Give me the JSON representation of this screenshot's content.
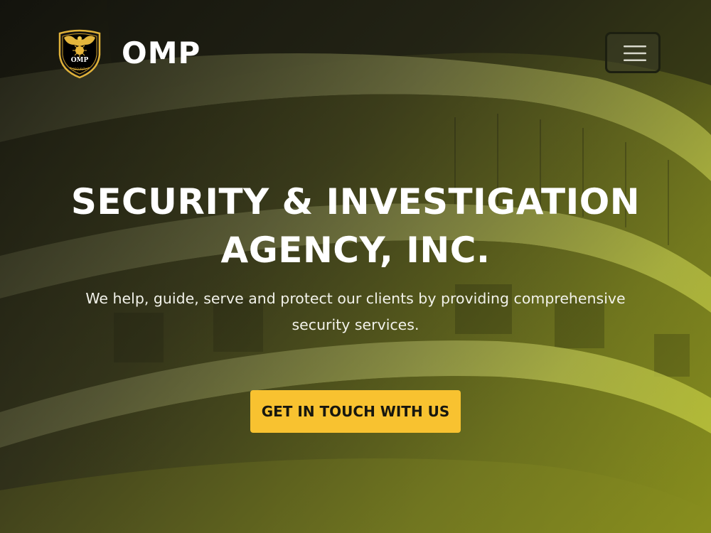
{
  "brand": {
    "name": "OMP",
    "logo_icon": "eagle-shield-logo-icon",
    "logo_text": "OMP",
    "logo_ribbon": "SECURITY"
  },
  "nav": {
    "toggle_icon": "hamburger-menu-icon"
  },
  "hero": {
    "title_line1": "SECURITY & INVESTIGATION",
    "title_line2": "AGENCY, INC.",
    "subtitle_line1": "We help, guide, serve and protect our clients by providing comprehensive",
    "subtitle_line2": "security services.",
    "cta_label": "GET IN TOUCH WITH US",
    "background": "building-photo-background"
  },
  "colors": {
    "accent": "#f8c230",
    "overlay_dark": "#12120c",
    "overlay_tint": "#aab414",
    "text": "#ffffff",
    "button_text": "#17170f"
  }
}
